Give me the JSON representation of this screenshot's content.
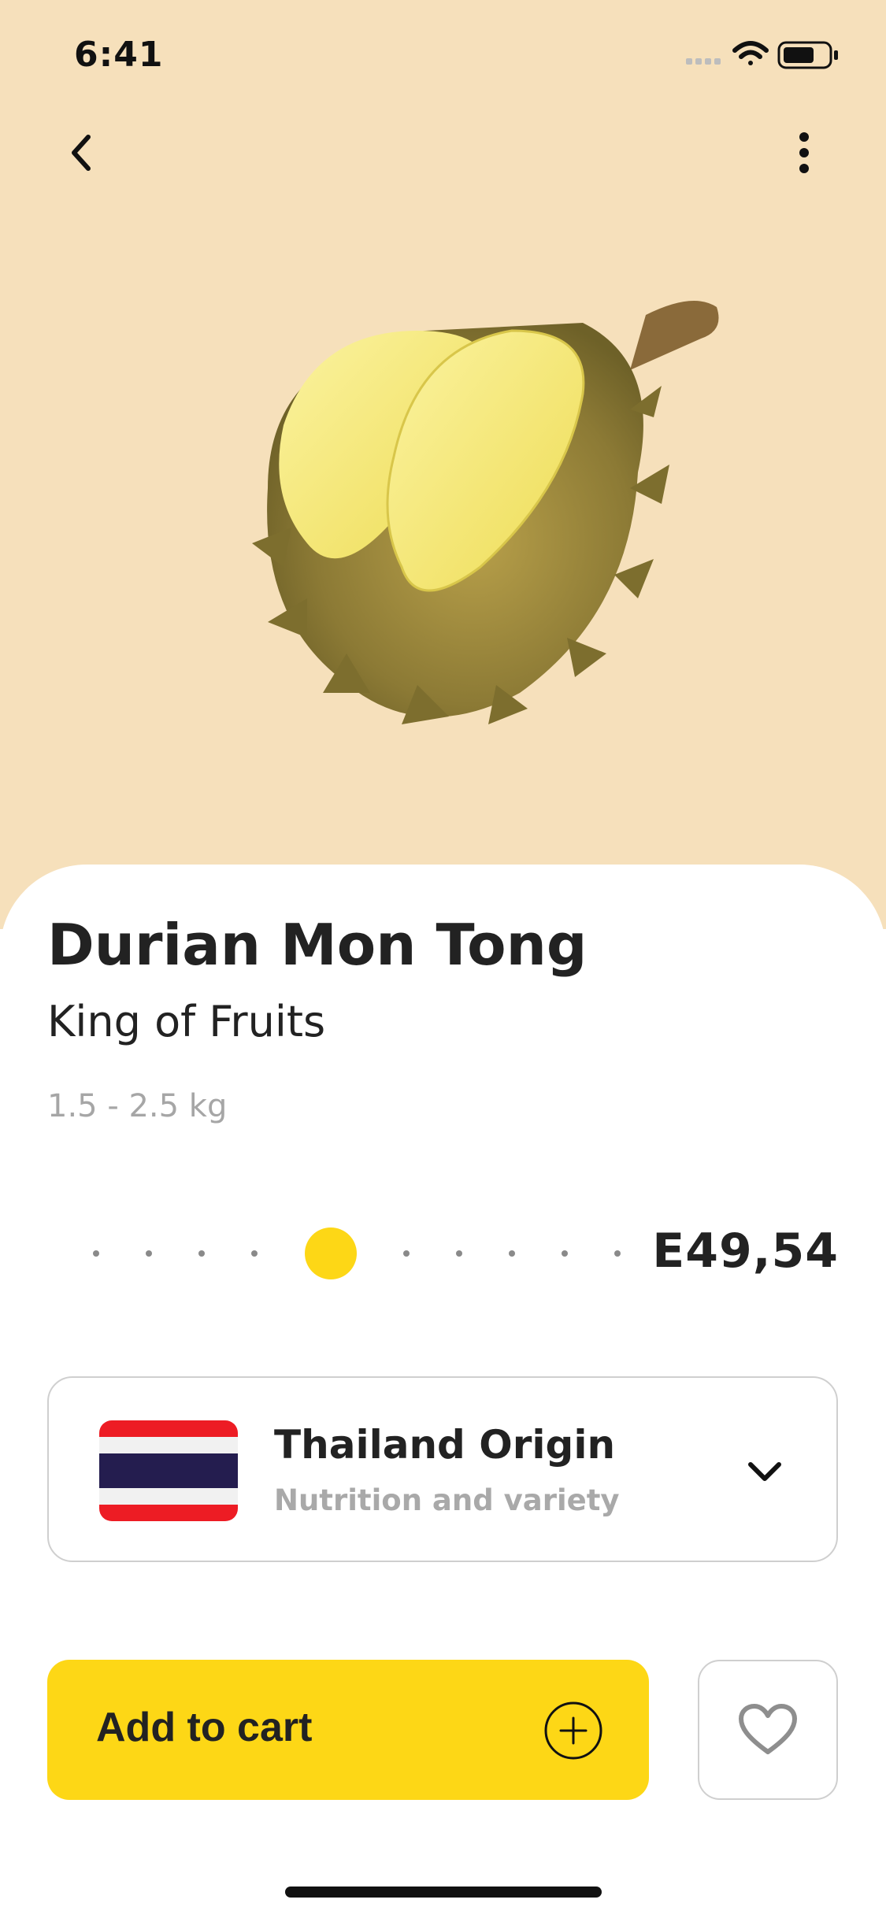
{
  "status_bar": {
    "time": "6:41"
  },
  "product": {
    "name": "Durian Mon Tong",
    "subtitle": "King of Fruits",
    "weight": "1.5 - 2.5 kg",
    "price": "E49,54"
  },
  "origin": {
    "title": "Thailand Origin",
    "subtitle": "Nutrition and variety",
    "flag_colors": [
      "#ed1c24",
      "#f1f1f1",
      "#241d4f"
    ]
  },
  "actions": {
    "add_to_cart_label": "Add to cart"
  },
  "colors": {
    "hero_background": "#f6e0bb",
    "accent": "#fdd716",
    "text": "#222222",
    "muted": "#a6a6a6"
  },
  "icons": {
    "back": "chevron-left-icon",
    "more": "more-vertical-icon",
    "expand": "chevron-down-icon",
    "add": "plus-circle-icon",
    "favorite": "heart-icon"
  }
}
